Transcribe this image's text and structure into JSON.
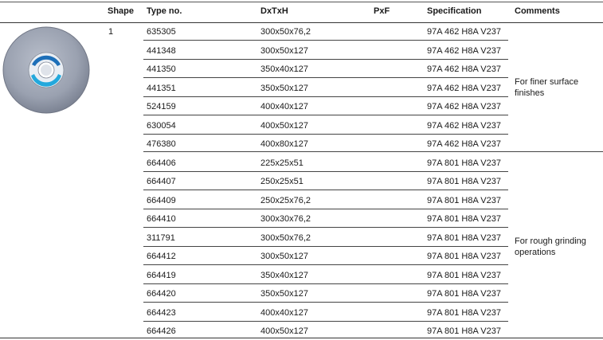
{
  "headers": {
    "shape": "Shape",
    "type_no": "Type no.",
    "dxtxh": "DxTxH",
    "pxf": "PxF",
    "specification": "Specification",
    "comments": "Comments"
  },
  "shape_value": "1",
  "product_image": "grinding-wheel",
  "rows": [
    {
      "type_no": "635305",
      "dxtxh": "300x50x76,2",
      "spec": "97A 462 H8A V237"
    },
    {
      "type_no": "441348",
      "dxtxh": "300x50x127",
      "spec": "97A 462 H8A V237"
    },
    {
      "type_no": "441350",
      "dxtxh": "350x40x127",
      "spec": "97A 462 H8A V237"
    },
    {
      "type_no": "441351",
      "dxtxh": "350x50x127",
      "spec": "97A 462 H8A V237"
    },
    {
      "type_no": "524159",
      "dxtxh": "400x40x127",
      "spec": "97A 462 H8A V237"
    },
    {
      "type_no": "630054",
      "dxtxh": "400x50x127",
      "spec": "97A 462 H8A V237"
    },
    {
      "type_no": "476380",
      "dxtxh": "400x80x127",
      "spec": "97A 462 H8A V237"
    },
    {
      "type_no": "664406",
      "dxtxh": "225x25x51",
      "spec": "97A 801 H8A V237"
    },
    {
      "type_no": "664407",
      "dxtxh": "250x25x51",
      "spec": "97A 801 H8A V237"
    },
    {
      "type_no": "664409",
      "dxtxh": "250x25x76,2",
      "spec": "97A 801 H8A V237"
    },
    {
      "type_no": "664410",
      "dxtxh": "300x30x76,2",
      "spec": "97A 801 H8A V237"
    },
    {
      "type_no": "311791",
      "dxtxh": "300x50x76,2",
      "spec": "97A 801 H8A V237"
    },
    {
      "type_no": "664412",
      "dxtxh": "300x50x127",
      "spec": "97A 801 H8A V237"
    },
    {
      "type_no": "664419",
      "dxtxh": "350x40x127",
      "spec": "97A 801 H8A V237"
    },
    {
      "type_no": "664420",
      "dxtxh": "350x50x127",
      "spec": "97A 801 H8A V237"
    },
    {
      "type_no": "664423",
      "dxtxh": "400x40x127",
      "spec": "97A 801 H8A V237"
    },
    {
      "type_no": "664426",
      "dxtxh": "400x50x127",
      "spec": "97A 801 H8A V237"
    }
  ],
  "comments": {
    "group1_line1": "For finer surface",
    "group1_line2": "finishes",
    "group2_line1": "For rough grinding",
    "group2_line2": "operations"
  }
}
